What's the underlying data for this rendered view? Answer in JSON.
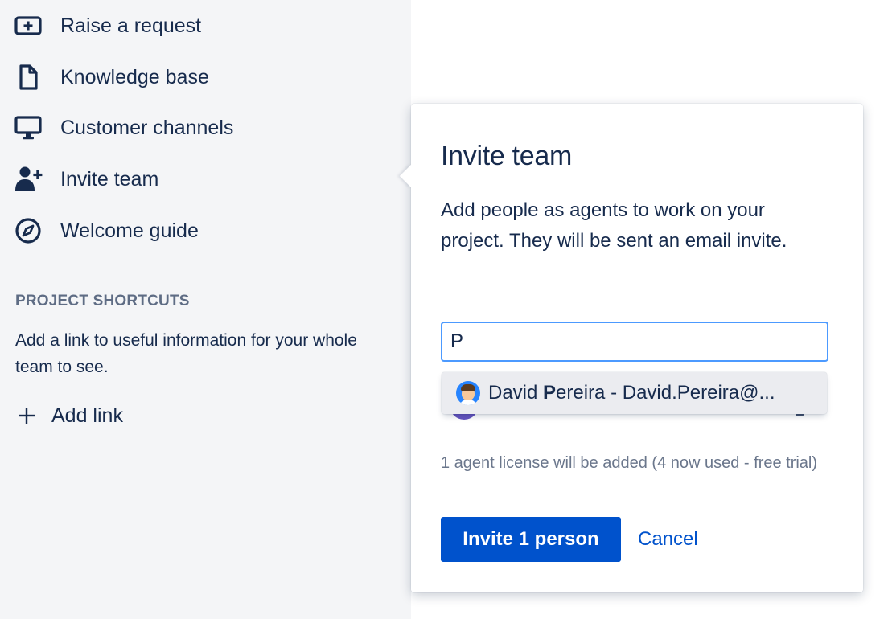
{
  "sidebar": {
    "items": [
      {
        "label": "Raise a request",
        "icon": "plus-box-icon"
      },
      {
        "label": "Knowledge base",
        "icon": "page-icon"
      },
      {
        "label": "Customer channels",
        "icon": "monitor-icon"
      },
      {
        "label": "Invite team",
        "icon": "person-add-icon"
      },
      {
        "label": "Welcome guide",
        "icon": "compass-icon"
      }
    ],
    "shortcuts_title": "PROJECT SHORTCUTS",
    "shortcuts_desc": "Add a link to useful information for your whole team to see.",
    "add_link_label": "Add link",
    "add_link_icon": "plus-icon"
  },
  "popup": {
    "title": "Invite team",
    "description": "Add people as agents to work on your project. They will be sent an email invite.",
    "input_value": "P",
    "suggestion": {
      "avatar_icon": "user-avatar",
      "prefix": "David ",
      "match": "P",
      "suffix": "ereira - David.Pereira@..."
    },
    "license_note": "1 agent license will be added (4 now used - free trial)",
    "primary_button": "Invite 1 person",
    "cancel_button": "Cancel"
  },
  "colors": {
    "sidebar_bg": "#f4f5f7",
    "text": "#172b4d",
    "primary": "#0052cc",
    "focus_border": "#4c9aff",
    "muted": "#6b778c",
    "suggestion_bg": "#ebecf0"
  }
}
